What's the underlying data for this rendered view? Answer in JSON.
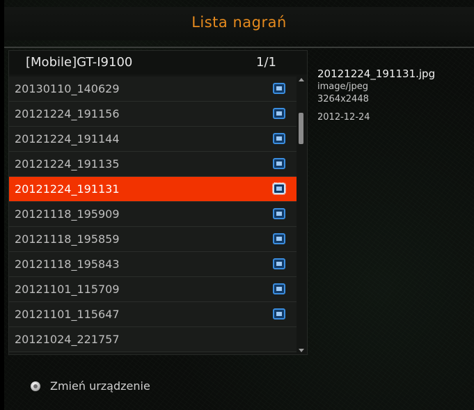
{
  "header": {
    "title": "Lista nagrań"
  },
  "list": {
    "device": "[Mobile]GT-I9100",
    "page": "1/1",
    "items": [
      {
        "label": "20130110_140629",
        "icon": "image-file-icon"
      },
      {
        "label": "20121224_191156",
        "icon": "image-file-icon"
      },
      {
        "label": "20121224_191144",
        "icon": "image-file-icon"
      },
      {
        "label": "20121224_191135",
        "icon": "image-file-icon"
      },
      {
        "label": "20121224_191131",
        "icon": "image-file-icon",
        "selected": true
      },
      {
        "label": "20121118_195909",
        "icon": "image-file-icon"
      },
      {
        "label": "20121118_195859",
        "icon": "image-file-icon"
      },
      {
        "label": "20121118_195843",
        "icon": "image-file-icon"
      },
      {
        "label": "20121101_115709",
        "icon": "image-file-icon"
      },
      {
        "label": "20121101_115647",
        "icon": "image-file-icon"
      },
      {
        "label": "20121024_221757"
      }
    ]
  },
  "details": {
    "filename": "20121224_191131.jpg",
    "mime": "image/jpeg",
    "resolution": "3264x2448",
    "date": "2012-12-24"
  },
  "footer": {
    "hint": "Zmień urządzenie",
    "icon": "remote-button-icon"
  },
  "colors": {
    "title": "#e58a1e",
    "selection": "#f23300",
    "icon": "#3b8ee0"
  }
}
